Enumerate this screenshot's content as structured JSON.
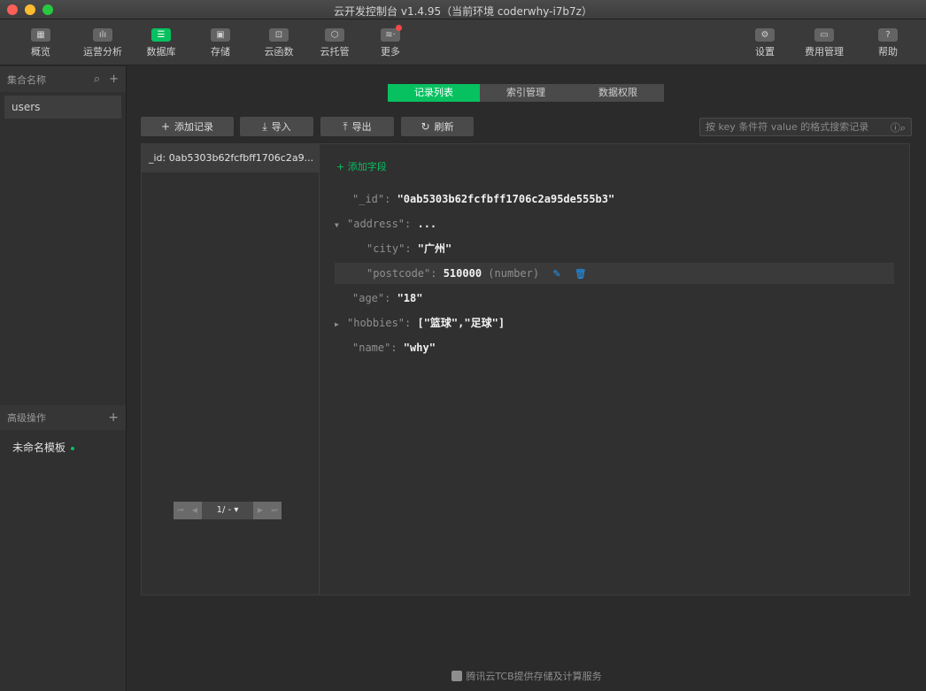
{
  "window": {
    "title": "云开发控制台 v1.4.95（当前环境 coderwhy-i7b7z）"
  },
  "toolbar": {
    "left": [
      {
        "label": "概览",
        "glyph": "▦",
        "icon": "overview-icon"
      },
      {
        "label": "运营分析",
        "glyph": "ılı",
        "icon": "analytics-icon"
      },
      {
        "label": "数据库",
        "glyph": "☰",
        "icon": "database-icon",
        "active": true
      },
      {
        "label": "存储",
        "glyph": "▣",
        "icon": "storage-icon"
      },
      {
        "label": "云函数",
        "glyph": "⊡",
        "icon": "cloud-function-icon"
      },
      {
        "label": "云托管",
        "glyph": "⬡",
        "icon": "cloud-hosting-icon"
      },
      {
        "label": "更多",
        "glyph": "≋·",
        "icon": "more-icon"
      }
    ],
    "right": [
      {
        "label": "设置",
        "glyph": "⚙",
        "icon": "settings-icon"
      },
      {
        "label": "费用管理",
        "glyph": "▭",
        "icon": "billing-icon"
      },
      {
        "label": "帮助",
        "glyph": "?",
        "icon": "help-icon"
      }
    ]
  },
  "sidebar": {
    "header": "集合名称",
    "collections": [
      "users"
    ],
    "advanced_header": "高级操作",
    "template": "未命名模板"
  },
  "main": {
    "tabs": [
      "记录列表",
      "索引管理",
      "数据权限"
    ],
    "actions": {
      "add": "添加记录",
      "import": "导入",
      "export": "导出",
      "refresh": "刷新"
    },
    "search_placeholder": "按 key 条件符 value 的格式搜索记录",
    "records": [
      "_id: 0ab5303b62fcfbff1706c2a9..."
    ],
    "pager": "1/ - ▾",
    "add_field": "添加字段",
    "doc": {
      "id_key": "\"_id\": ",
      "id_val": "\"0ab5303b62fcfbff1706c2a95de555b3\"",
      "address_key": "\"address\": ",
      "address_val": "...",
      "city_key": "\"city\": ",
      "city_val": "\"广州\"",
      "postcode_key": "\"postcode\": ",
      "postcode_val": "510000",
      "postcode_type": "(number)",
      "age_key": "\"age\": ",
      "age_val": "\"18\"",
      "hobbies_key": "\"hobbies\": ",
      "hobbies_val": "[\"篮球\",\"足球\"]",
      "name_key": "\"name\": ",
      "name_val": "\"why\""
    },
    "footer": "腾讯云TCB提供存储及计算服务"
  },
  "colors": {
    "accent": "#07c160",
    "link": "#1f9cff",
    "badge": "#f54848"
  }
}
